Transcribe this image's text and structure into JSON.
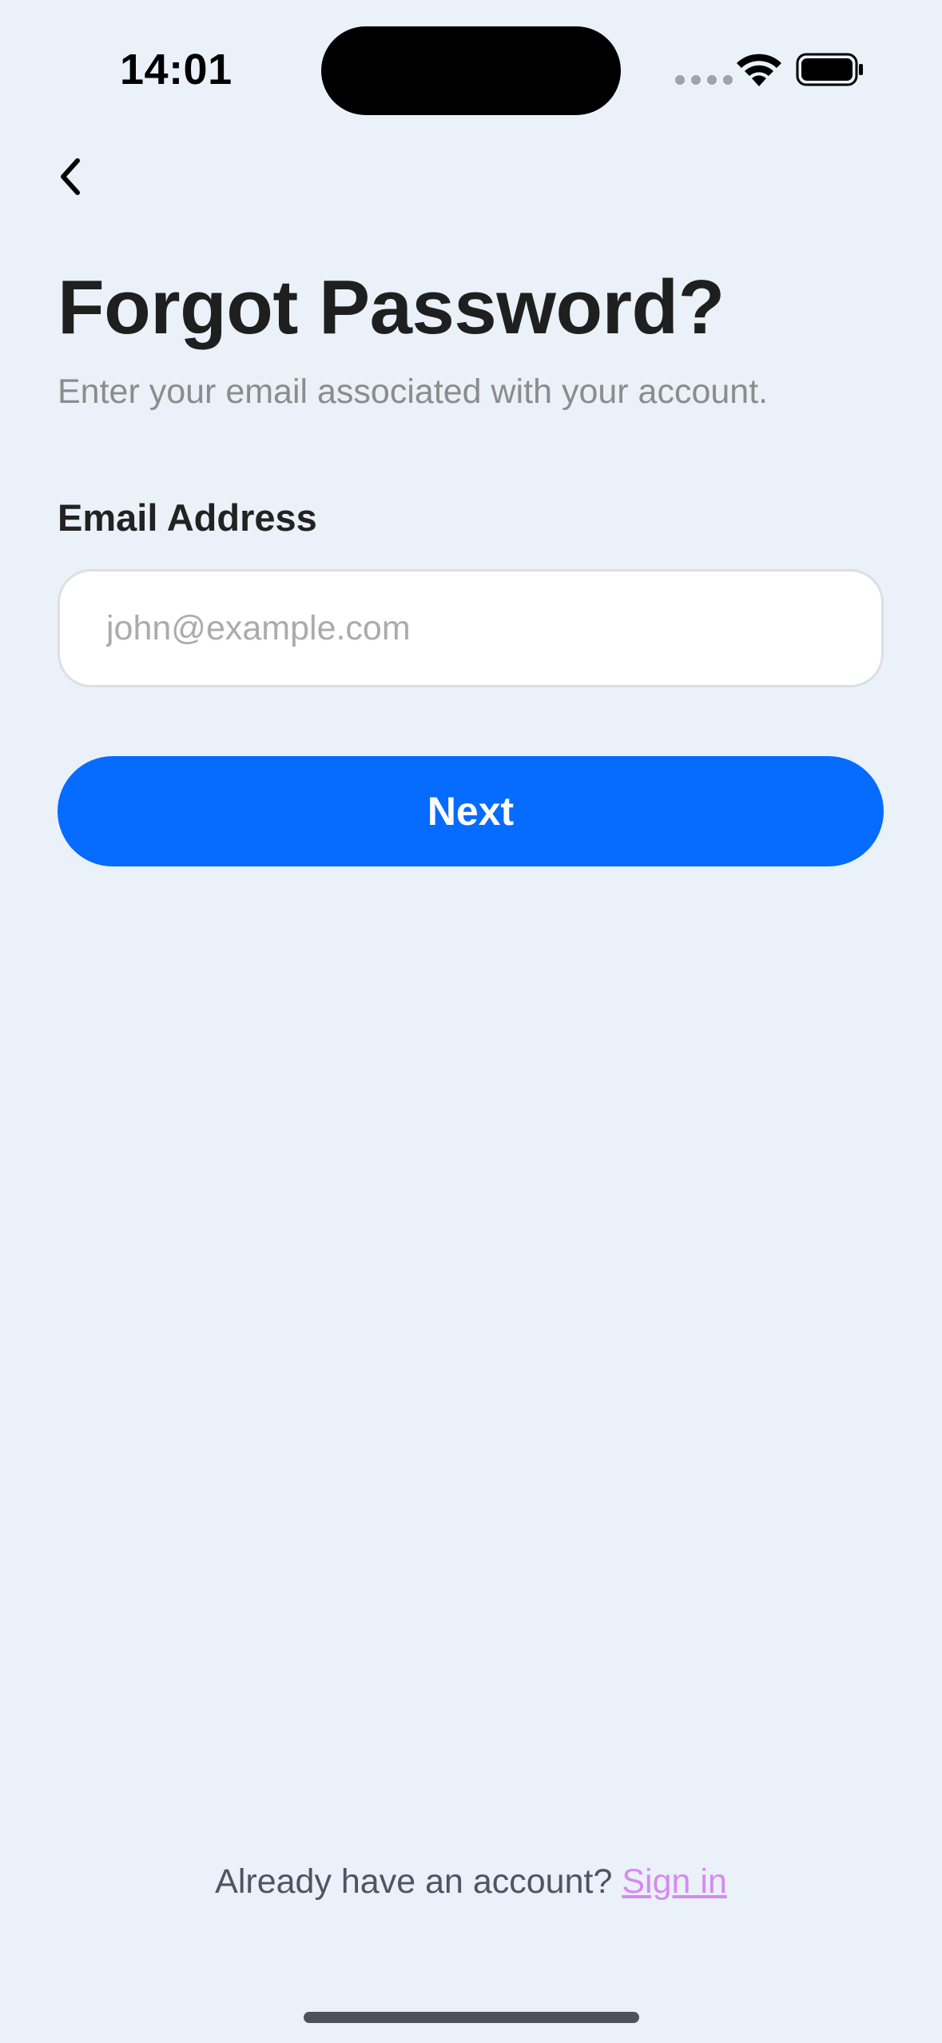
{
  "status_bar": {
    "time": "14:01"
  },
  "icons": {
    "back": "chevron-left-icon",
    "wifi": "wifi-icon",
    "battery": "battery-icon"
  },
  "header": {
    "title": "Forgot Password?",
    "subtitle": "Enter your email associated with your account."
  },
  "form": {
    "email_label": "Email Address",
    "email_value": "",
    "email_placeholder": "john@example.com",
    "next_label": "Next"
  },
  "footer": {
    "prompt": "Already have an account?",
    "link_label": "Sign in"
  },
  "colors": {
    "background": "#EAF1F9",
    "primary": "#066BFF",
    "link": "#D58BF0"
  }
}
